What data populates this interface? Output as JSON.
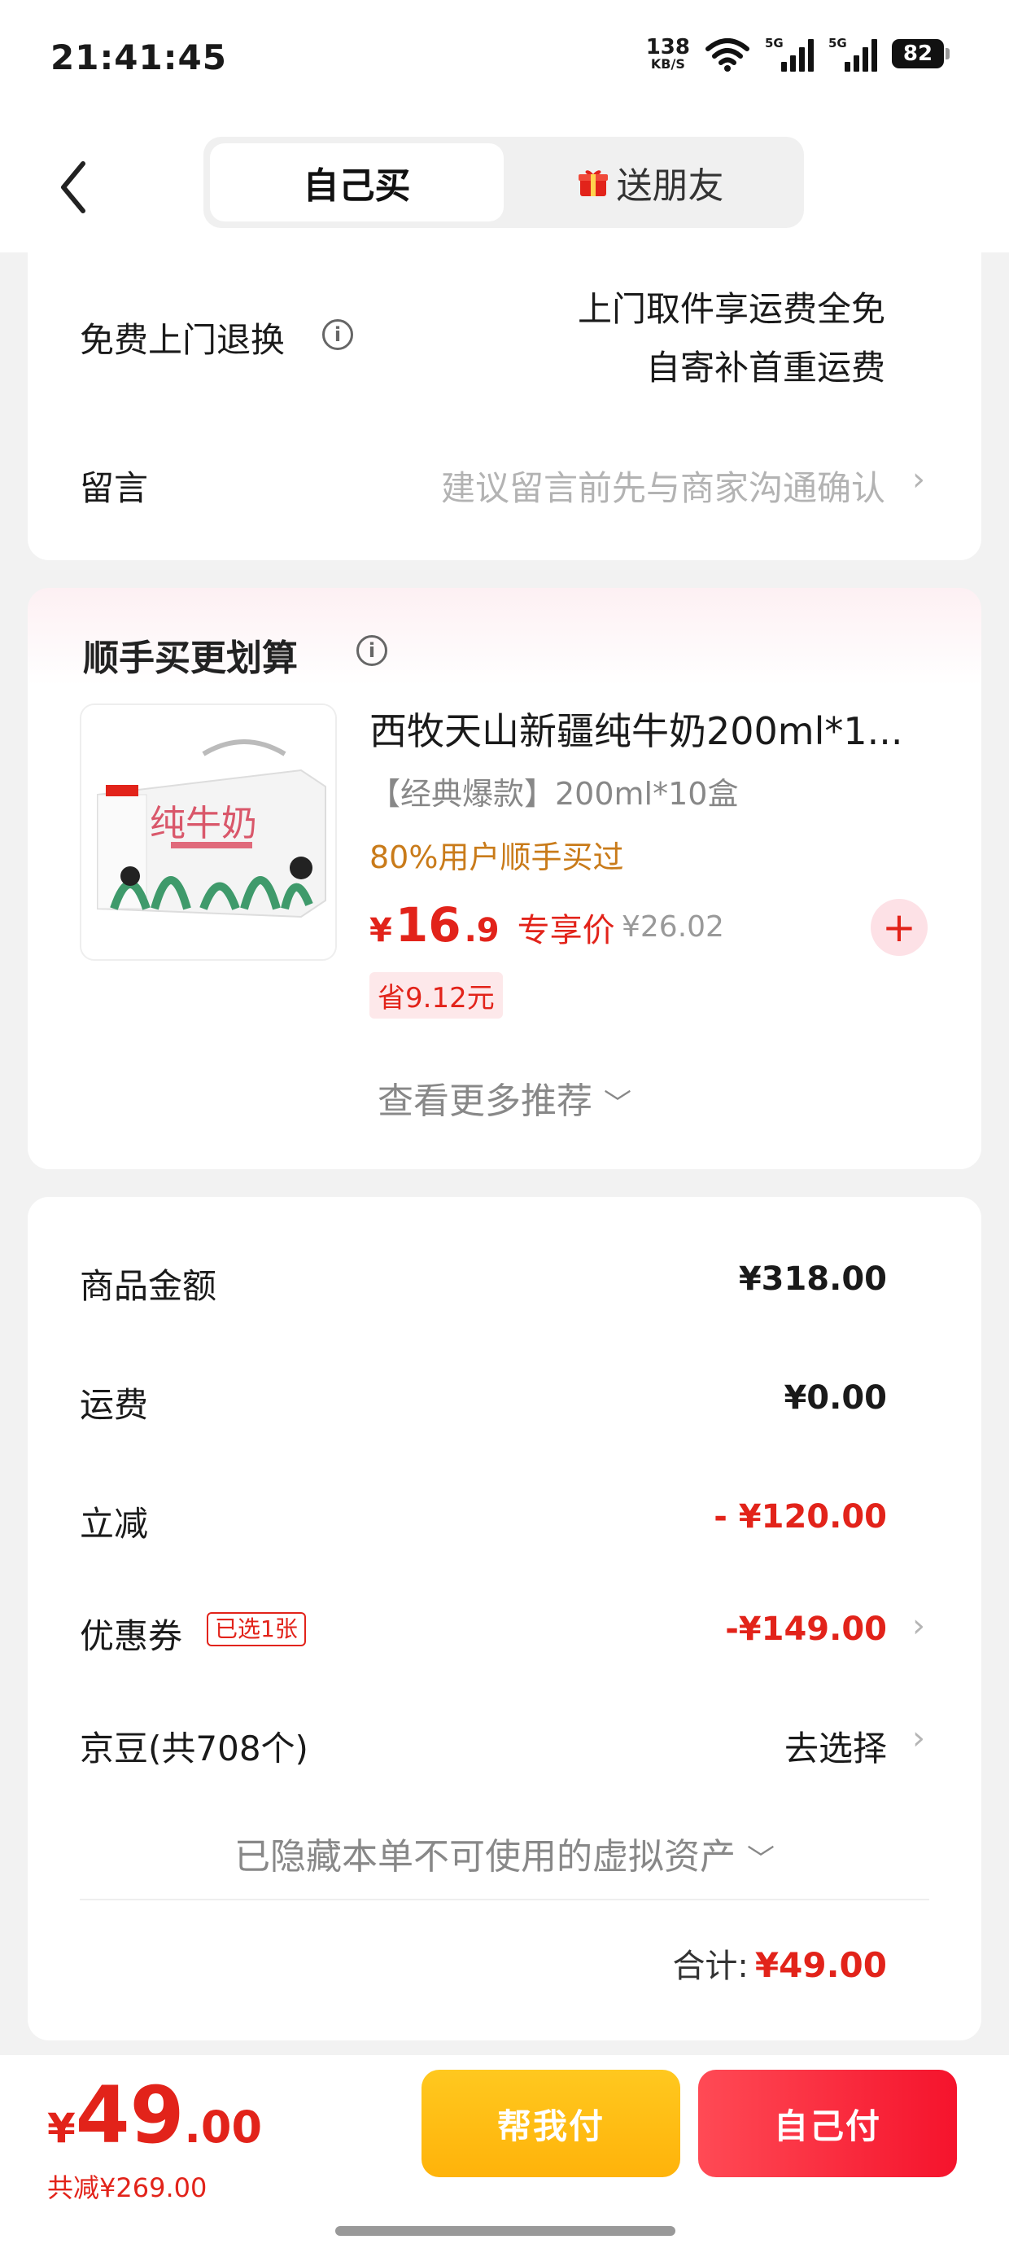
{
  "status_bar": {
    "time": "21:41:45",
    "net_speed": "138",
    "net_unit": "KB/S",
    "signal1": "5G",
    "signal2": "5G",
    "battery": "82"
  },
  "header": {
    "tabs": [
      {
        "label": "自己买",
        "active": true
      },
      {
        "label": "送朋友",
        "active": false
      }
    ]
  },
  "service": {
    "return_label": "免费上门退换",
    "return_desc_line1": "上门取件享运费全免",
    "return_desc_line2": "自寄补首重运费",
    "message_label": "留言",
    "message_placeholder": "建议留言前先与商家沟通确认"
  },
  "addon": {
    "title": "顺手买更划算",
    "product": {
      "name": "西牧天山新疆纯牛奶200ml*1...",
      "spec": "【经典爆款】200ml*10盒",
      "tag": "80%用户顺手买过",
      "price_symbol": "¥",
      "price_int": "16",
      "price_dec": ".9",
      "price_label": "专享价",
      "orig_price": "¥26.02",
      "save": "省9.12元",
      "thumb_text": "纯牛奶"
    },
    "more": "查看更多推荐"
  },
  "summary": {
    "rows": [
      {
        "label": "商品金额",
        "value": "¥318.00"
      },
      {
        "label": "运费",
        "value": "¥0.00"
      },
      {
        "label": "立减",
        "value": "- ¥120.00"
      },
      {
        "label": "优惠券",
        "value": "-¥149.00",
        "badge": "已选1张"
      },
      {
        "label": "京豆(共708个)",
        "value": "去选择"
      }
    ],
    "hidden_assets": "已隐藏本单不可使用的虚拟资产",
    "total_label": "合计:",
    "total_value": "¥49.00"
  },
  "bottom": {
    "price_symbol": "¥",
    "price_int": "49",
    "price_dec": ".00",
    "saved": "共减¥269.00",
    "help_pay": "帮我付",
    "self_pay": "自己付"
  },
  "colors": {
    "accent_red": "#e2231a",
    "help_yellow": "#ffb30a",
    "pay_red": "#f5132c"
  }
}
